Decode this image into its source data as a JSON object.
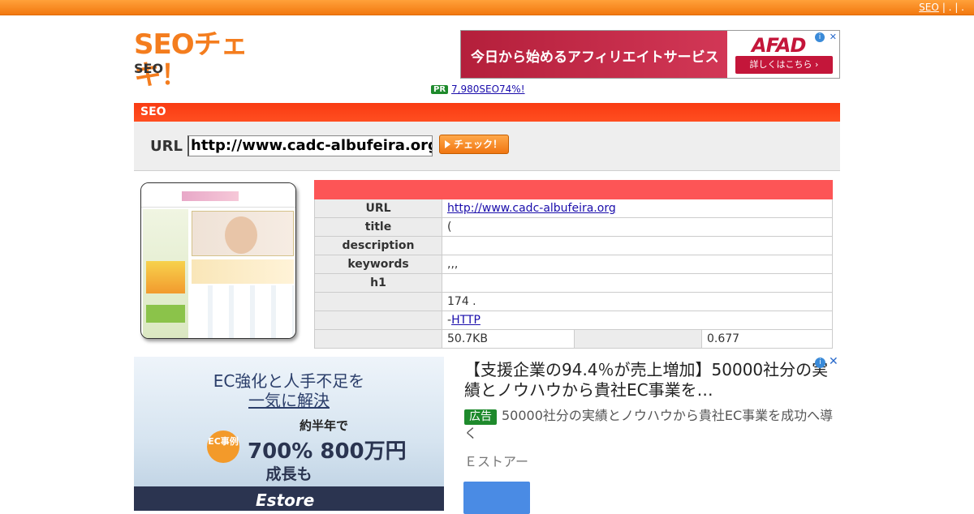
{
  "topbar": {
    "link_text": "SEO",
    "sep": "| . | ."
  },
  "logo": {
    "mark": "SEOチェキ！",
    "sub": "SEO"
  },
  "ad_banner": {
    "message": "今日から始めるアフィリエイトサービス",
    "brand": "AFAD",
    "cta": "詳しくはこちら ›"
  },
  "pr": {
    "badge": "PR",
    "text": "7,980SEO74%!"
  },
  "section": {
    "title": "SEO"
  },
  "form": {
    "url_label": "URL",
    "url_value": "http://www.cadc-albufeira.org",
    "check_label": "チェック！"
  },
  "table": {
    "rows": [
      {
        "key": "URL",
        "value": "http://www.cadc-albufeira.org"
      },
      {
        "key": "title",
        "value": "("
      },
      {
        "key": "description",
        "value": ""
      },
      {
        "key": "keywords",
        "value": ",,,"
      },
      {
        "key": "h1",
        "value": ""
      },
      {
        "key": "",
        "value": "174 ."
      },
      {
        "key": "",
        "value_prefix": "-",
        "value_link": "HTTP"
      }
    ],
    "last_row": {
      "size": "50.7KB",
      "time": "0.677"
    }
  },
  "ec_ad": {
    "img_line1": "EC強化と人手不足を",
    "img_line2": "一気に解決",
    "img_line3": "約半年で",
    "img_badge": "EC事例",
    "img_stats": "700% 800万円",
    "img_line4": "成長も",
    "img_brand": "Estore",
    "title": "【支援企業の94.4％が売上増加】50000社分の実績とノウハウから貴社EC事業を…",
    "badge": "広告",
    "desc": "50000社分の実績とノウハウから貴社EC事業を成功へ導く",
    "advertiser": "Ｅストアー"
  }
}
